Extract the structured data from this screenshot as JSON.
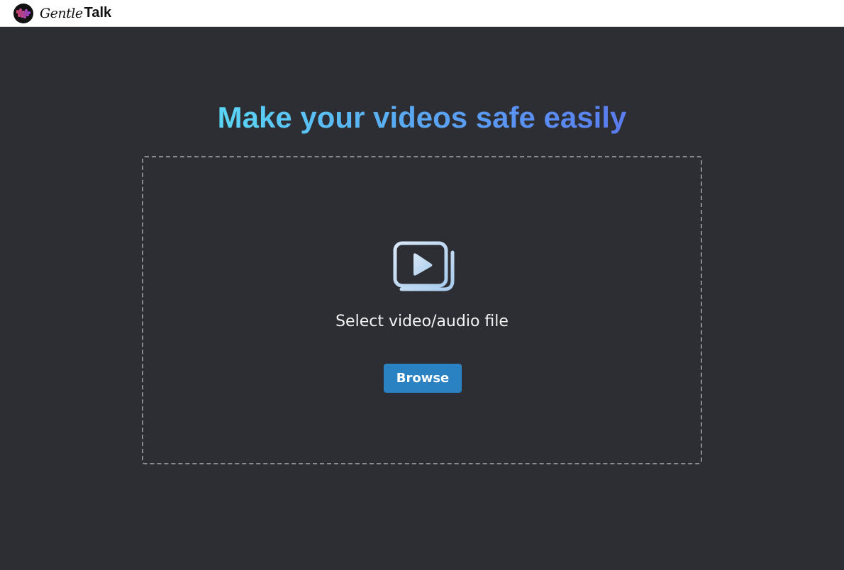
{
  "app": {
    "logo_script": "Gentle",
    "logo_bold": "Talk",
    "logo_icon": "soundwave-logo-icon"
  },
  "main": {
    "headline": "Make your videos safe easily",
    "headline_gradient": [
      "#5ad6f5",
      "#5a7cf0"
    ]
  },
  "upload": {
    "icon": "video-library-icon",
    "label": "Select video/audio file",
    "browse_label": "Browse"
  },
  "colors": {
    "background": "#2d2e33",
    "topbar": "#ffffff",
    "button": "#2b82c2",
    "logo_accent": "#e0389a"
  }
}
